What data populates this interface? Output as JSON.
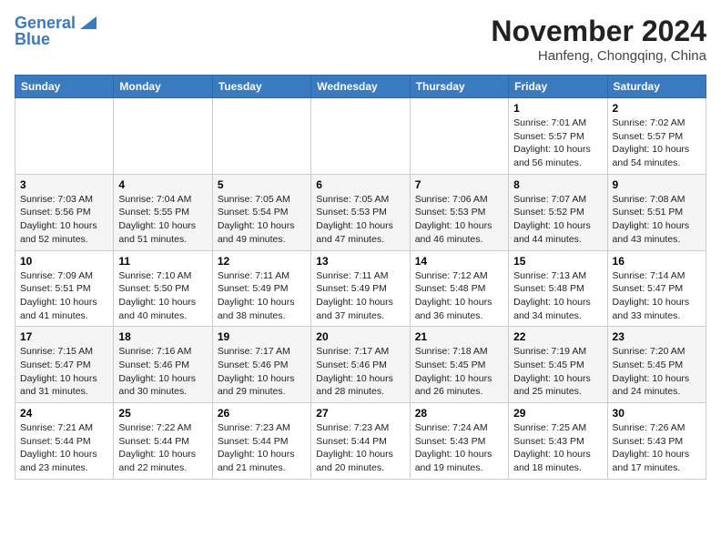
{
  "header": {
    "logo_line1": "General",
    "logo_line2": "Blue",
    "month": "November 2024",
    "location": "Hanfeng, Chongqing, China"
  },
  "weekdays": [
    "Sunday",
    "Monday",
    "Tuesday",
    "Wednesday",
    "Thursday",
    "Friday",
    "Saturday"
  ],
  "weeks": [
    [
      {
        "day": "",
        "info": ""
      },
      {
        "day": "",
        "info": ""
      },
      {
        "day": "",
        "info": ""
      },
      {
        "day": "",
        "info": ""
      },
      {
        "day": "",
        "info": ""
      },
      {
        "day": "1",
        "info": "Sunrise: 7:01 AM\nSunset: 5:57 PM\nDaylight: 10 hours and 56 minutes."
      },
      {
        "day": "2",
        "info": "Sunrise: 7:02 AM\nSunset: 5:57 PM\nDaylight: 10 hours and 54 minutes."
      }
    ],
    [
      {
        "day": "3",
        "info": "Sunrise: 7:03 AM\nSunset: 5:56 PM\nDaylight: 10 hours and 52 minutes."
      },
      {
        "day": "4",
        "info": "Sunrise: 7:04 AM\nSunset: 5:55 PM\nDaylight: 10 hours and 51 minutes."
      },
      {
        "day": "5",
        "info": "Sunrise: 7:05 AM\nSunset: 5:54 PM\nDaylight: 10 hours and 49 minutes."
      },
      {
        "day": "6",
        "info": "Sunrise: 7:05 AM\nSunset: 5:53 PM\nDaylight: 10 hours and 47 minutes."
      },
      {
        "day": "7",
        "info": "Sunrise: 7:06 AM\nSunset: 5:53 PM\nDaylight: 10 hours and 46 minutes."
      },
      {
        "day": "8",
        "info": "Sunrise: 7:07 AM\nSunset: 5:52 PM\nDaylight: 10 hours and 44 minutes."
      },
      {
        "day": "9",
        "info": "Sunrise: 7:08 AM\nSunset: 5:51 PM\nDaylight: 10 hours and 43 minutes."
      }
    ],
    [
      {
        "day": "10",
        "info": "Sunrise: 7:09 AM\nSunset: 5:51 PM\nDaylight: 10 hours and 41 minutes."
      },
      {
        "day": "11",
        "info": "Sunrise: 7:10 AM\nSunset: 5:50 PM\nDaylight: 10 hours and 40 minutes."
      },
      {
        "day": "12",
        "info": "Sunrise: 7:11 AM\nSunset: 5:49 PM\nDaylight: 10 hours and 38 minutes."
      },
      {
        "day": "13",
        "info": "Sunrise: 7:11 AM\nSunset: 5:49 PM\nDaylight: 10 hours and 37 minutes."
      },
      {
        "day": "14",
        "info": "Sunrise: 7:12 AM\nSunset: 5:48 PM\nDaylight: 10 hours and 36 minutes."
      },
      {
        "day": "15",
        "info": "Sunrise: 7:13 AM\nSunset: 5:48 PM\nDaylight: 10 hours and 34 minutes."
      },
      {
        "day": "16",
        "info": "Sunrise: 7:14 AM\nSunset: 5:47 PM\nDaylight: 10 hours and 33 minutes."
      }
    ],
    [
      {
        "day": "17",
        "info": "Sunrise: 7:15 AM\nSunset: 5:47 PM\nDaylight: 10 hours and 31 minutes."
      },
      {
        "day": "18",
        "info": "Sunrise: 7:16 AM\nSunset: 5:46 PM\nDaylight: 10 hours and 30 minutes."
      },
      {
        "day": "19",
        "info": "Sunrise: 7:17 AM\nSunset: 5:46 PM\nDaylight: 10 hours and 29 minutes."
      },
      {
        "day": "20",
        "info": "Sunrise: 7:17 AM\nSunset: 5:46 PM\nDaylight: 10 hours and 28 minutes."
      },
      {
        "day": "21",
        "info": "Sunrise: 7:18 AM\nSunset: 5:45 PM\nDaylight: 10 hours and 26 minutes."
      },
      {
        "day": "22",
        "info": "Sunrise: 7:19 AM\nSunset: 5:45 PM\nDaylight: 10 hours and 25 minutes."
      },
      {
        "day": "23",
        "info": "Sunrise: 7:20 AM\nSunset: 5:45 PM\nDaylight: 10 hours and 24 minutes."
      }
    ],
    [
      {
        "day": "24",
        "info": "Sunrise: 7:21 AM\nSunset: 5:44 PM\nDaylight: 10 hours and 23 minutes."
      },
      {
        "day": "25",
        "info": "Sunrise: 7:22 AM\nSunset: 5:44 PM\nDaylight: 10 hours and 22 minutes."
      },
      {
        "day": "26",
        "info": "Sunrise: 7:23 AM\nSunset: 5:44 PM\nDaylight: 10 hours and 21 minutes."
      },
      {
        "day": "27",
        "info": "Sunrise: 7:23 AM\nSunset: 5:44 PM\nDaylight: 10 hours and 20 minutes."
      },
      {
        "day": "28",
        "info": "Sunrise: 7:24 AM\nSunset: 5:43 PM\nDaylight: 10 hours and 19 minutes."
      },
      {
        "day": "29",
        "info": "Sunrise: 7:25 AM\nSunset: 5:43 PM\nDaylight: 10 hours and 18 minutes."
      },
      {
        "day": "30",
        "info": "Sunrise: 7:26 AM\nSunset: 5:43 PM\nDaylight: 10 hours and 17 minutes."
      }
    ]
  ]
}
